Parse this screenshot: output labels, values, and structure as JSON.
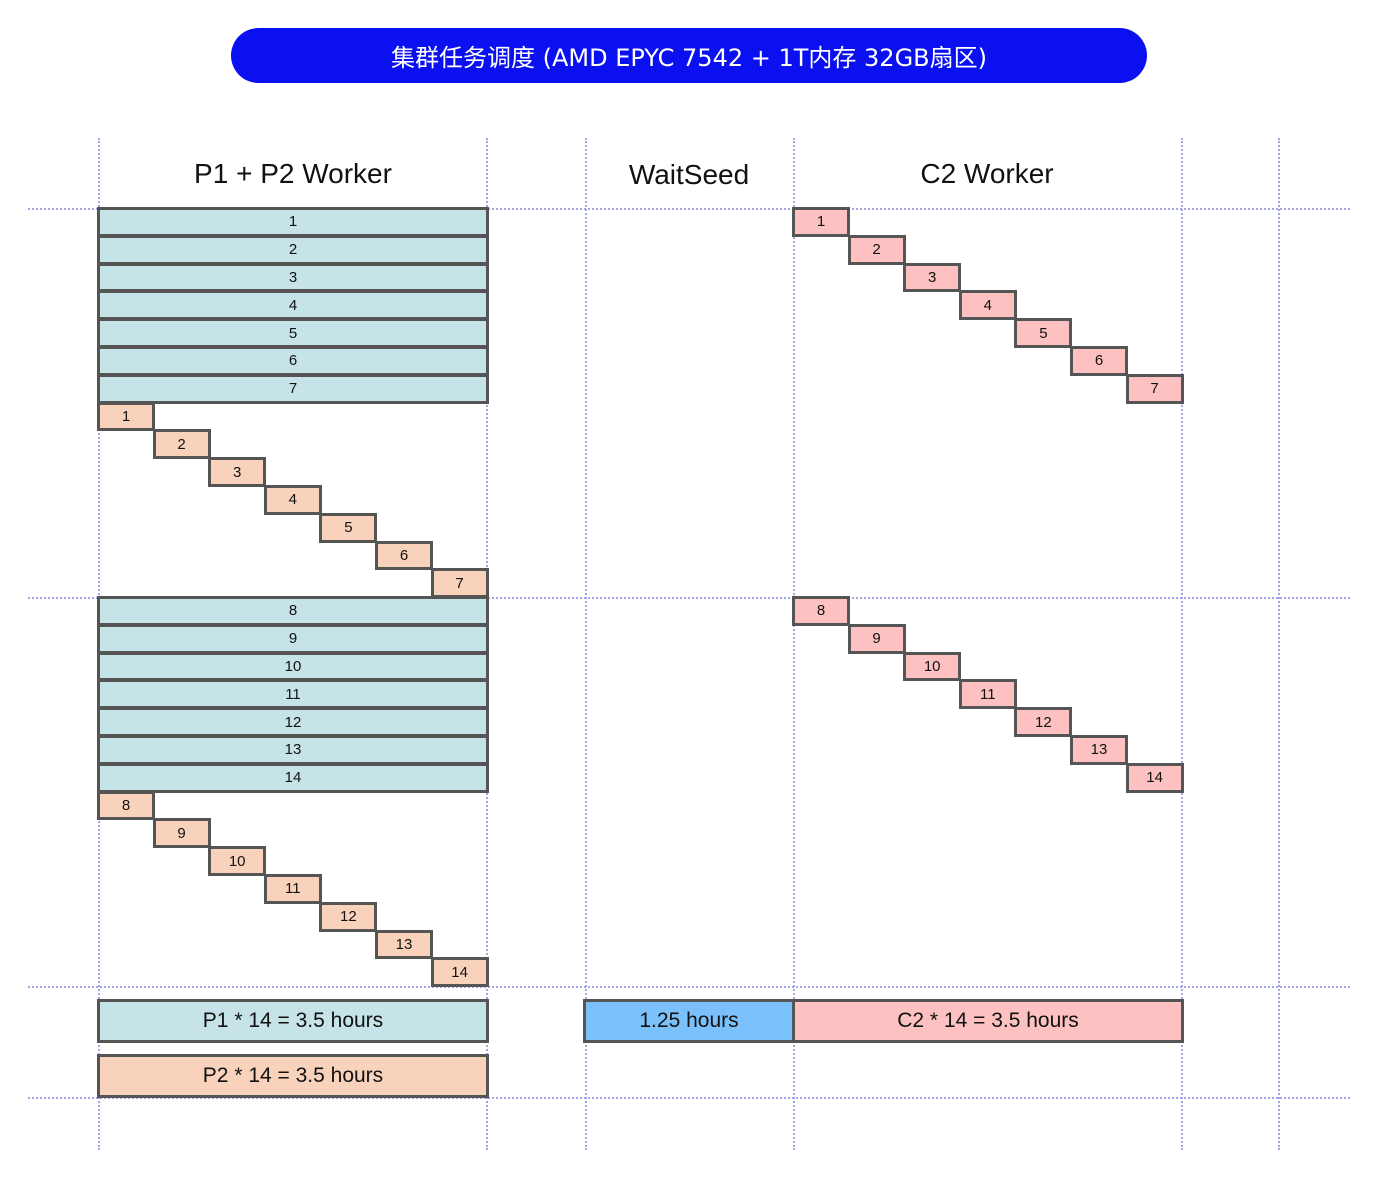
{
  "title": "集群任务调度 (AMD EPYC 7542 + 1T内存 32GB扇区)",
  "columns": {
    "p1p2": "P1 + P2 Worker",
    "wait": "WaitSeed",
    "c2": "C2 Worker"
  },
  "batches": [
    {
      "tasks": [
        "1",
        "2",
        "3",
        "4",
        "5",
        "6",
        "7"
      ]
    },
    {
      "tasks": [
        "8",
        "9",
        "10",
        "11",
        "12",
        "13",
        "14"
      ]
    }
  ],
  "summary": {
    "p1": "P1 * 14 = 3.5 hours",
    "p2": "P2 * 14 = 3.5 hours",
    "wait": "1.25 hours",
    "c2": "C2 * 14 = 3.5 hours"
  },
  "colors": {
    "title_bg": "#0a10f0",
    "p1": "#c6e4e8",
    "p2": "#f8d2bb",
    "c2": "#fdc1c1",
    "wait": "#7ac1fb",
    "border": "#555555",
    "grid": "#a3a3e8"
  }
}
